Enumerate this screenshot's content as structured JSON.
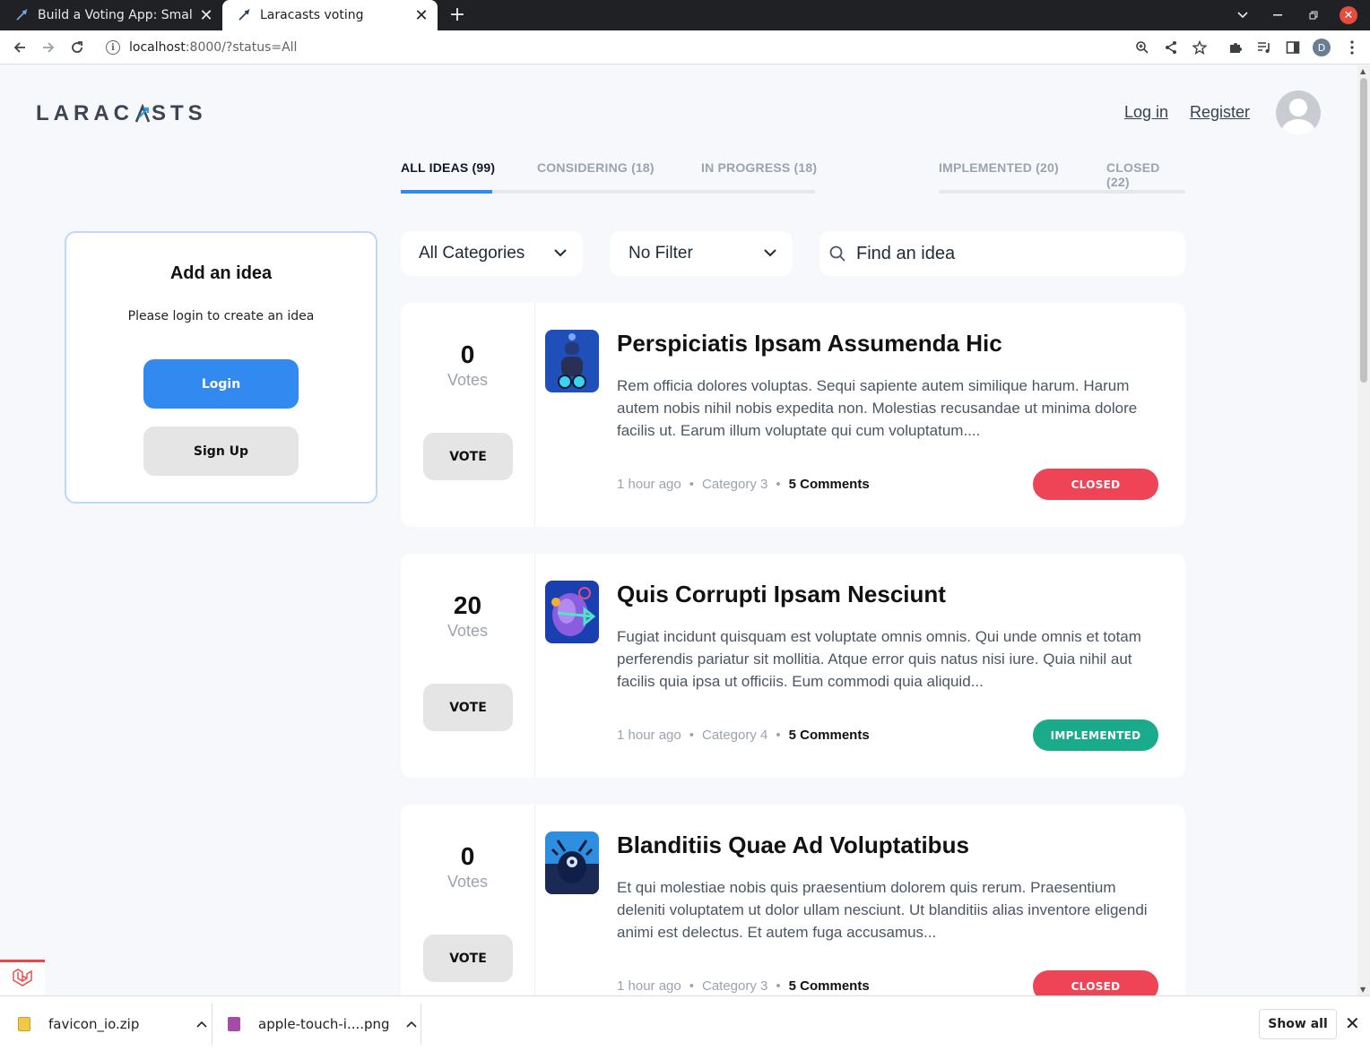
{
  "browser": {
    "tabs": [
      {
        "title": "Build a Voting App: Small"
      },
      {
        "title": "Laracasts voting"
      }
    ],
    "url_host": "localhost",
    "url_path": ":8000/?status=All",
    "profile_initial": "D"
  },
  "header": {
    "logo_text_left": "LARAC",
    "logo_text_right": "STS",
    "login_link": "Log in",
    "register_link": "Register"
  },
  "status_tabs": [
    {
      "label": "ALL IDEAS (99)"
    },
    {
      "label": "CONSIDERING (18)"
    },
    {
      "label": "IN PROGRESS (18)"
    },
    {
      "label": "IMPLEMENTED (20)"
    },
    {
      "label": "CLOSED (22)"
    }
  ],
  "sidebar": {
    "title": "Add an idea",
    "subtitle": "Please login to create an idea",
    "login_button": "Login",
    "signup_button": "Sign Up"
  },
  "filters": {
    "category": "All Categories",
    "other": "No Filter",
    "search_placeholder": "Find an idea"
  },
  "ideas": [
    {
      "votes": "0",
      "votes_label": "Votes",
      "vote_button": "VOTE",
      "title": "Perspiciatis Ipsam Assumenda Hic",
      "description": "Rem officia dolores voluptas. Sequi sapiente autem similique harum. Harum autem nobis nihil nobis expedita non. Molestias recusandae ut minima dolore facilis ut. Earum illum voluptate qui cum voluptatum....",
      "time": "1 hour ago",
      "category": "Category 3",
      "comments": "5 Comments",
      "status": "CLOSED",
      "status_color": "#ef4456"
    },
    {
      "votes": "20",
      "votes_label": "Votes",
      "vote_button": "VOTE",
      "title": "Quis Corrupti Ipsam Nesciunt",
      "description": "Fugiat incidunt quisquam est voluptate omnis omnis. Qui unde omnis et totam perferendis pariatur sit mollitia. Atque error quis natus nisi iure. Quia nihil aut facilis quia ipsa ut officiis. Eum commodi quia aliquid...",
      "time": "1 hour ago",
      "category": "Category 4",
      "comments": "5 Comments",
      "status": "IMPLEMENTED",
      "status_color": "#1aab8b"
    },
    {
      "votes": "0",
      "votes_label": "Votes",
      "vote_button": "VOTE",
      "title": "Blanditiis Quae Ad Voluptatibus",
      "description": "Et qui molestiae nobis quis praesentium dolorem quis rerum. Praesentium deleniti voluptatem ut dolor ullam nesciunt. Ut blanditiis alias inventore eligendi animi est delectus. Et autem fuga accusamus...",
      "time": "1 hour ago",
      "category": "Category 3",
      "comments": "5 Comments",
      "status": "CLOSED",
      "status_color": "#ef4456"
    }
  ],
  "downloads": [
    {
      "name": "favicon_io.zip"
    },
    {
      "name": "apple-touch-i....png"
    }
  ],
  "downloads_show_all": "Show all",
  "colors": {
    "accent": "#328af1",
    "closed": "#ef4456",
    "implemented": "#1aab8b"
  }
}
